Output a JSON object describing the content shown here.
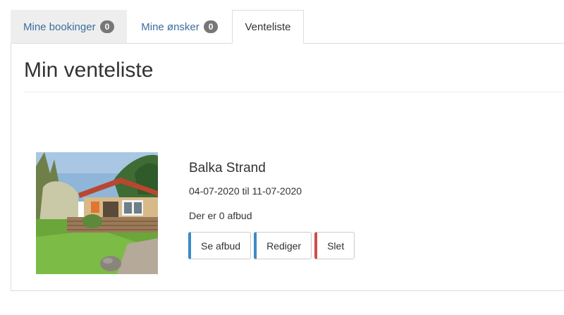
{
  "tabs": [
    {
      "label": "Mine bookinger",
      "badge": "0"
    },
    {
      "label": "Mine ønsker",
      "badge": "0"
    },
    {
      "label": "Venteliste"
    }
  ],
  "page": {
    "title": "Min venteliste"
  },
  "item": {
    "name": "Balka Strand",
    "dates": "04-07-2020 til 11-07-2020",
    "cancellations": "Der er 0 afbud",
    "buttons": {
      "view": "Se afbud",
      "edit": "Rediger",
      "delete": "Slet"
    }
  },
  "colors": {
    "link": "#3a6e9e",
    "badge": "#777777",
    "accent_blue": "#3d8ac7",
    "accent_red": "#cf4b4b"
  }
}
